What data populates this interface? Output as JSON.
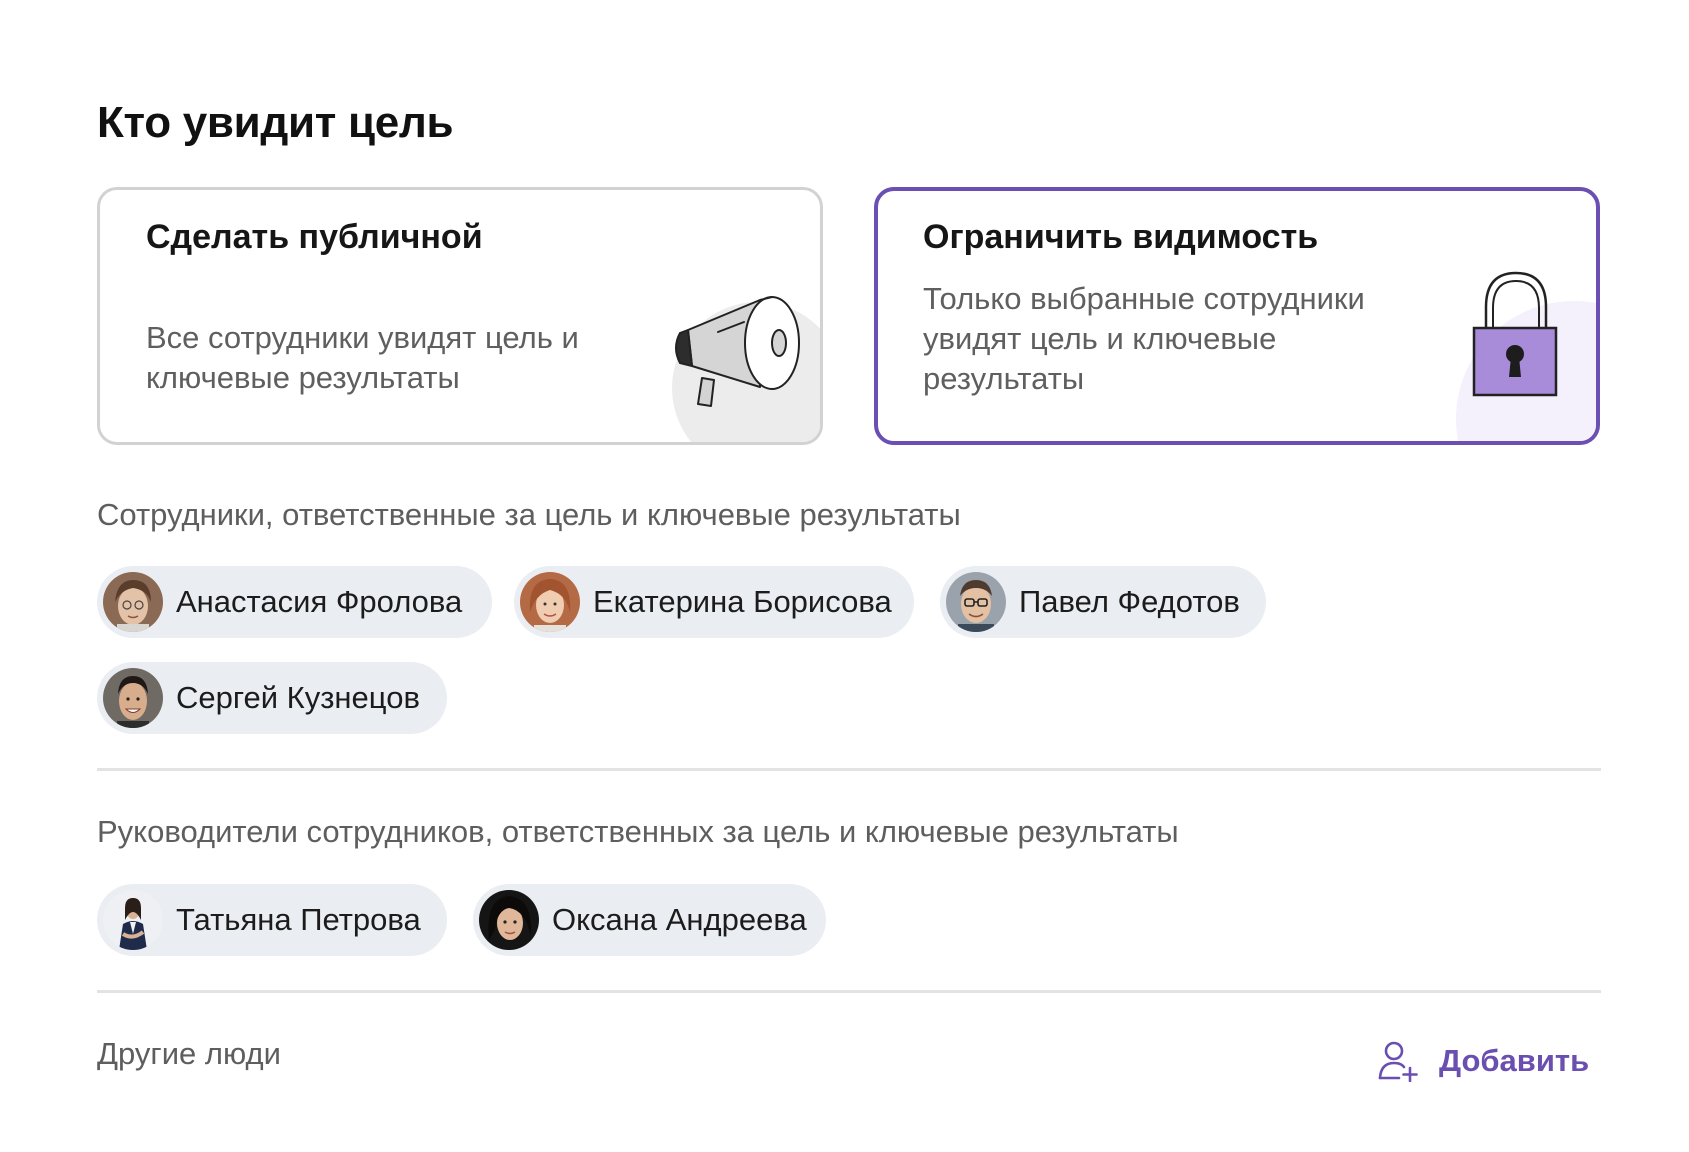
{
  "title": "Кто увидит цель",
  "options": {
    "public": {
      "title": "Сделать публичной",
      "description": "Все сотрудники увидят цель и ключевые результаты",
      "icon": "megaphone-icon"
    },
    "restricted": {
      "title": "Ограничить видимость",
      "description": "Только выбранные сотрудники увидят цель и ключевые результаты",
      "icon": "lock-icon",
      "selected": true
    }
  },
  "responsible": {
    "label": "Сотрудники, ответственные за цель и ключевые результаты",
    "people": [
      {
        "name": "Анастасия Фролова"
      },
      {
        "name": "Екатерина Борисова"
      },
      {
        "name": "Павел Федотов"
      },
      {
        "name": "Сергей Кузнецов"
      }
    ]
  },
  "managers": {
    "label": "Руководители сотрудников, ответственных за цель и ключевые результаты",
    "people": [
      {
        "name": "Татьяна Петрова"
      },
      {
        "name": "Оксана Андреева"
      }
    ]
  },
  "others": {
    "label": "Другие люди",
    "add_label": "Добавить",
    "add_icon": "add-person-icon"
  },
  "colors": {
    "accent": "#6b4fb3",
    "chip_background": "#eaeef2",
    "lock_fill": "#a88bd9"
  }
}
